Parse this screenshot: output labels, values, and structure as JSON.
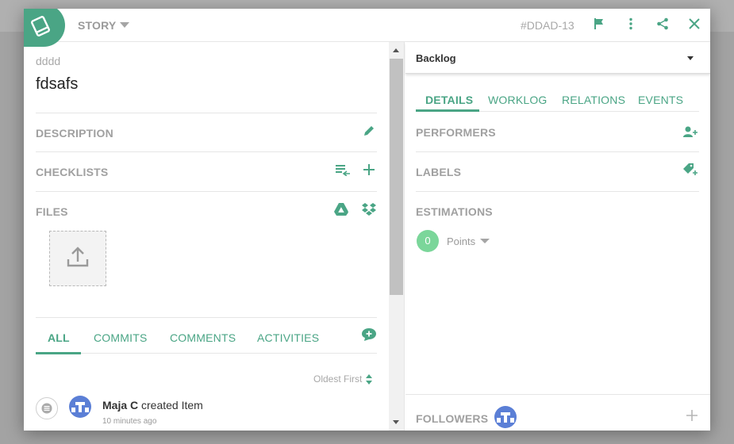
{
  "colors": {
    "accent": "#4aa585",
    "points": "#7bd69a",
    "muted": "#a0a0a0"
  },
  "header": {
    "type_label": "STORY",
    "issue_key": "#DDAD-13",
    "icons": [
      "book-icon",
      "flag-icon",
      "more-vertical-icon",
      "share-icon",
      "close-icon"
    ]
  },
  "item": {
    "parent": "dddd",
    "title": "fdsafs"
  },
  "sections": {
    "description": "DESCRIPTION",
    "checklists": "CHECKLISTS",
    "files": "FILES"
  },
  "activity_tabs": {
    "all": "ALL",
    "commits": "COMMITS",
    "comments": "COMMENTS",
    "activities": "ACTIVITIES",
    "active": "ALL"
  },
  "sort_label": "Oldest First",
  "activity": [
    {
      "user": "Maja C",
      "action": "created Item",
      "time": "10 minutes ago"
    }
  ],
  "status": {
    "value": "Backlog"
  },
  "detail_tabs": {
    "details": "DETAILS",
    "worklog": "WORKLOG",
    "relations": "RELATIONS",
    "events": "EVENTS",
    "active": "DETAILS"
  },
  "right_sections": {
    "performers": "PERFORMERS",
    "labels": "LABELS",
    "estimations": "ESTIMATIONS",
    "followers": "FOLLOWERS"
  },
  "estimation": {
    "points_value": "0",
    "points_label": "Points"
  }
}
